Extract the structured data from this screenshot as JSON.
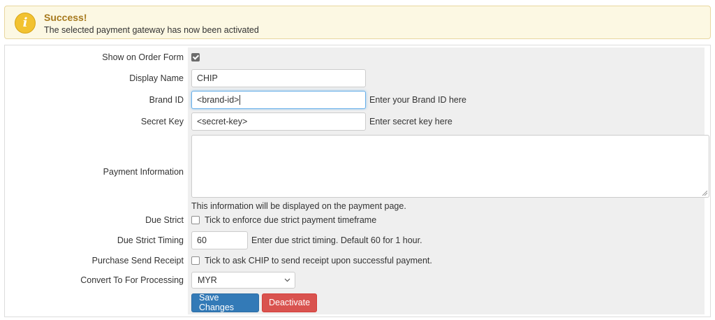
{
  "alert": {
    "icon": "info-icon",
    "title": "Success!",
    "message": "The selected payment gateway has now been activated"
  },
  "form": {
    "show_on_order_form": {
      "label": "Show on Order Form",
      "checked": true
    },
    "display_name": {
      "label": "Display Name",
      "value": "CHIP"
    },
    "brand_id": {
      "label": "Brand ID",
      "value": "<brand-id>",
      "hint": "Enter your Brand ID here"
    },
    "secret_key": {
      "label": "Secret Key",
      "value": "<secret-key>",
      "hint": "Enter secret key here"
    },
    "payment_information": {
      "label": "Payment Information",
      "value": "",
      "help": "This information will be displayed on the payment page."
    },
    "due_strict": {
      "label": "Due Strict",
      "checkbox_label": "Tick to enforce due strict payment timeframe",
      "checked": false
    },
    "due_strict_timing": {
      "label": "Due Strict Timing",
      "value": "60",
      "hint": "Enter due strict timing. Default 60 for 1 hour."
    },
    "purchase_send_receipt": {
      "label": "Purchase Send Receipt",
      "checkbox_label": "Tick to ask CHIP to send receipt upon successful payment.",
      "checked": false
    },
    "convert_to": {
      "label": "Convert To For Processing",
      "selected": "MYR"
    }
  },
  "buttons": {
    "save": "Save Changes",
    "deactivate": "Deactivate"
  },
  "colors": {
    "primary": "#337ab7",
    "danger": "#d9534f",
    "alert_bg": "#fcf8e3",
    "alert_title": "#a6791d"
  }
}
